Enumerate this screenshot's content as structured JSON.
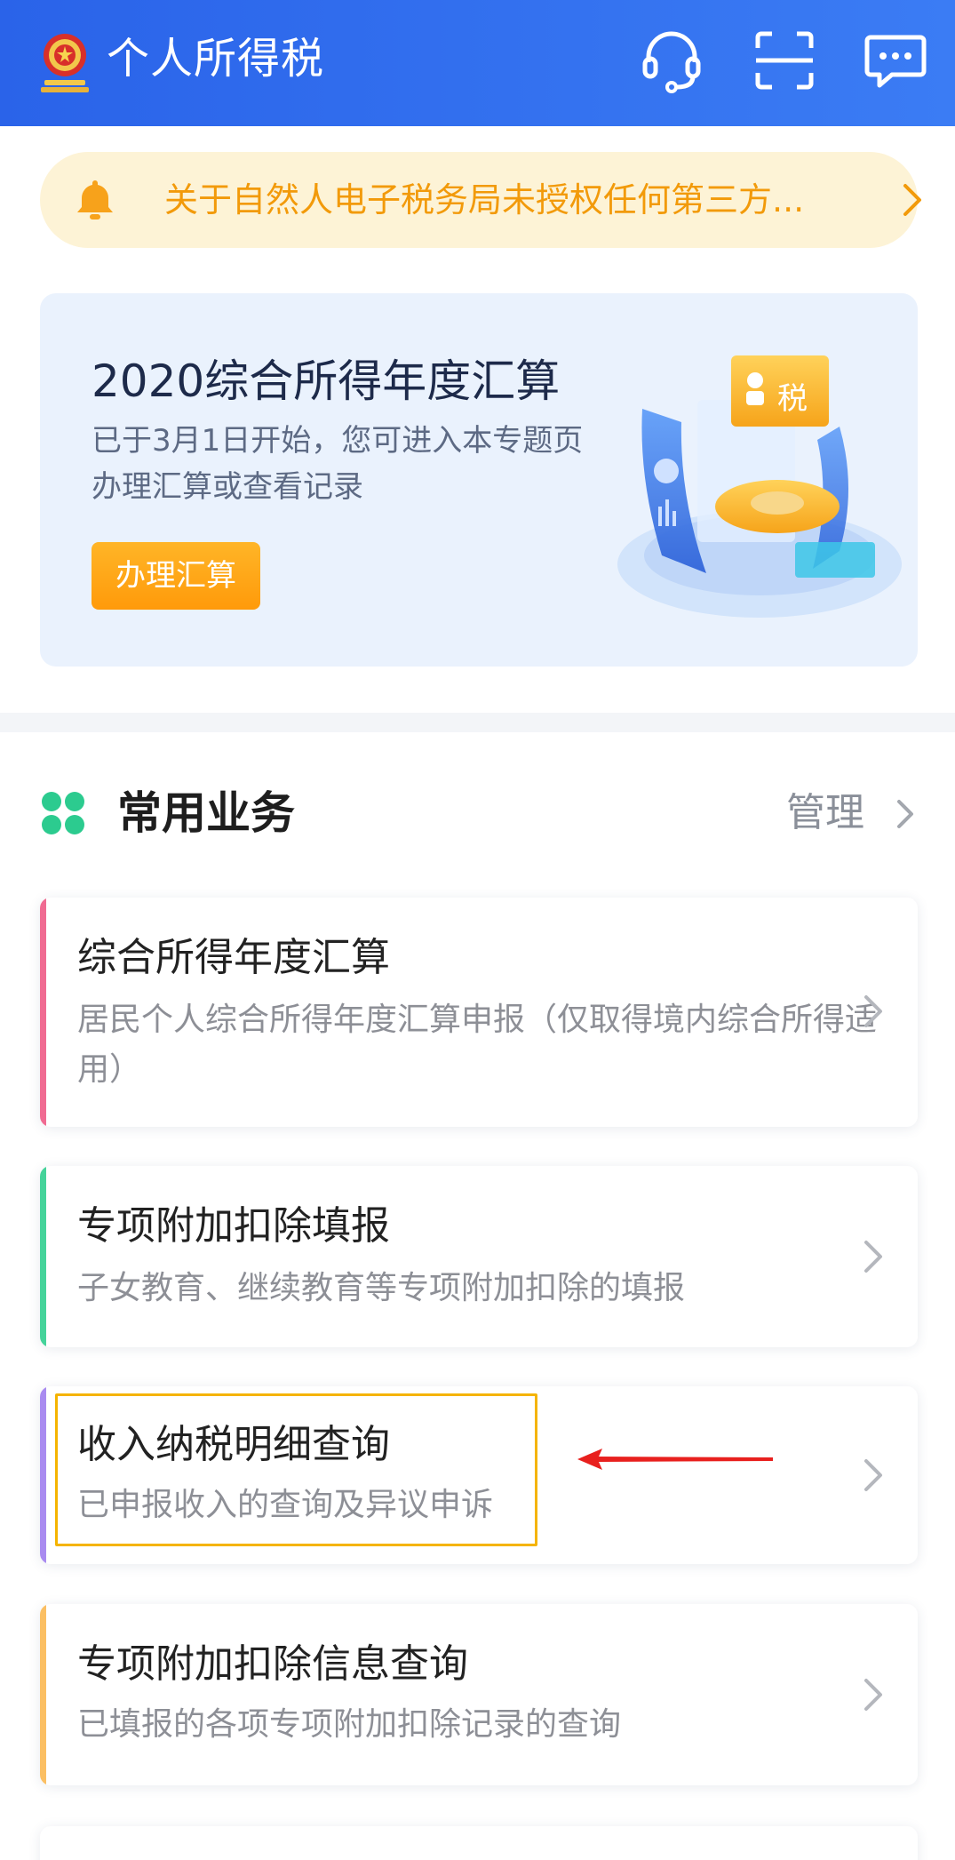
{
  "header": {
    "title": "个人所得税",
    "icons": [
      "emblem-icon",
      "headset-icon",
      "scan-icon",
      "message-icon"
    ]
  },
  "notice": {
    "text": "关于自然人电子税务局未授权任何第三方..."
  },
  "banner": {
    "title": "2020综合所得年度汇算",
    "desc": "已于3月1日开始，您可进入本专题页办理汇算或查看记录",
    "button": "办理汇算",
    "illustration_badge": "税"
  },
  "section": {
    "title": "常用业务",
    "manage": "管理"
  },
  "cards": [
    {
      "title": "综合所得年度汇算",
      "desc": "居民个人综合所得年度汇算申报（仅取得境内综合所得适用）",
      "accent": "#f06b92"
    },
    {
      "title": "专项附加扣除填报",
      "desc": "子女教育、继续教育等专项附加扣除的填报",
      "accent": "#45d39a"
    },
    {
      "title": "收入纳税明细查询",
      "desc": "已申报收入的查询及异议申诉",
      "accent": "#a98bf0"
    },
    {
      "title": "专项附加扣除信息查询",
      "desc": "已填报的各项专项附加扣除记录的查询",
      "accent": "#fbbf63"
    }
  ],
  "colors": {
    "header_start": "#2a63e9",
    "header_end": "#3b7cf4",
    "notice_text": "#f29a0a",
    "highlight_border": "#f5b400",
    "annotation_arrow": "#e8201e"
  }
}
